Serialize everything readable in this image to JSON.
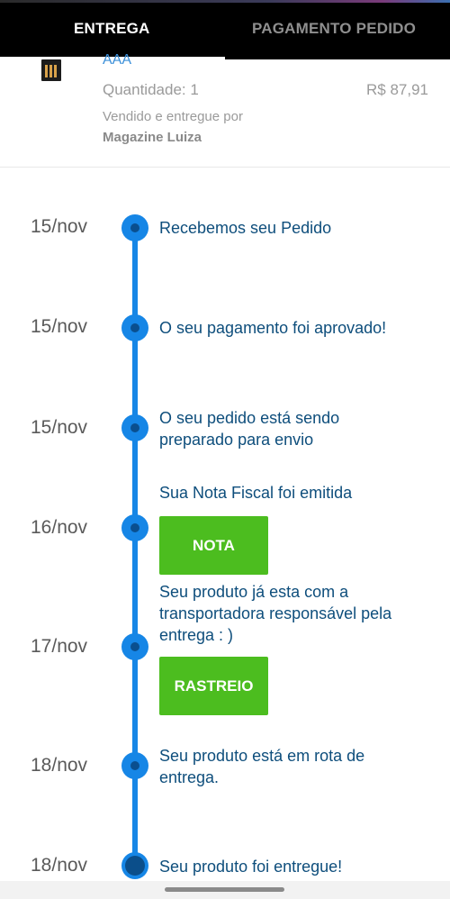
{
  "tabs": [
    {
      "label": "ENTREGA",
      "active": true
    },
    {
      "label": "PAGAMENTO PEDIDO",
      "active": false
    }
  ],
  "product": {
    "name": "AAA",
    "quantity": "Quantidade: 1",
    "price": "R$ 87,91",
    "sold_by": "Vendido e entregue por",
    "store": "Magazine Luiza"
  },
  "timeline": [
    {
      "date": "15/nov",
      "text": "Recebemos seu Pedido"
    },
    {
      "date": "15/nov",
      "text": "O seu pagamento foi aprovado!"
    },
    {
      "date": "15/nov",
      "text": "O seu pedido está sendo preparado para envio"
    },
    {
      "date": "16/nov",
      "text": "Sua Nota Fiscal foi emitida",
      "button": "NOTA"
    },
    {
      "date": "17/nov",
      "text": "Seu produto já esta com a transportadora responsável pela entrega : )",
      "button": "RASTREIO"
    },
    {
      "date": "18/nov",
      "text": "Seu produto está em rota de entrega."
    },
    {
      "date": "18/nov",
      "text": "Seu produto foi entregue!"
    }
  ],
  "colors": {
    "accent": "#1686e6",
    "button": "#4cbd1f",
    "event_text": "#0e4e7c",
    "topbar": "#000000"
  }
}
